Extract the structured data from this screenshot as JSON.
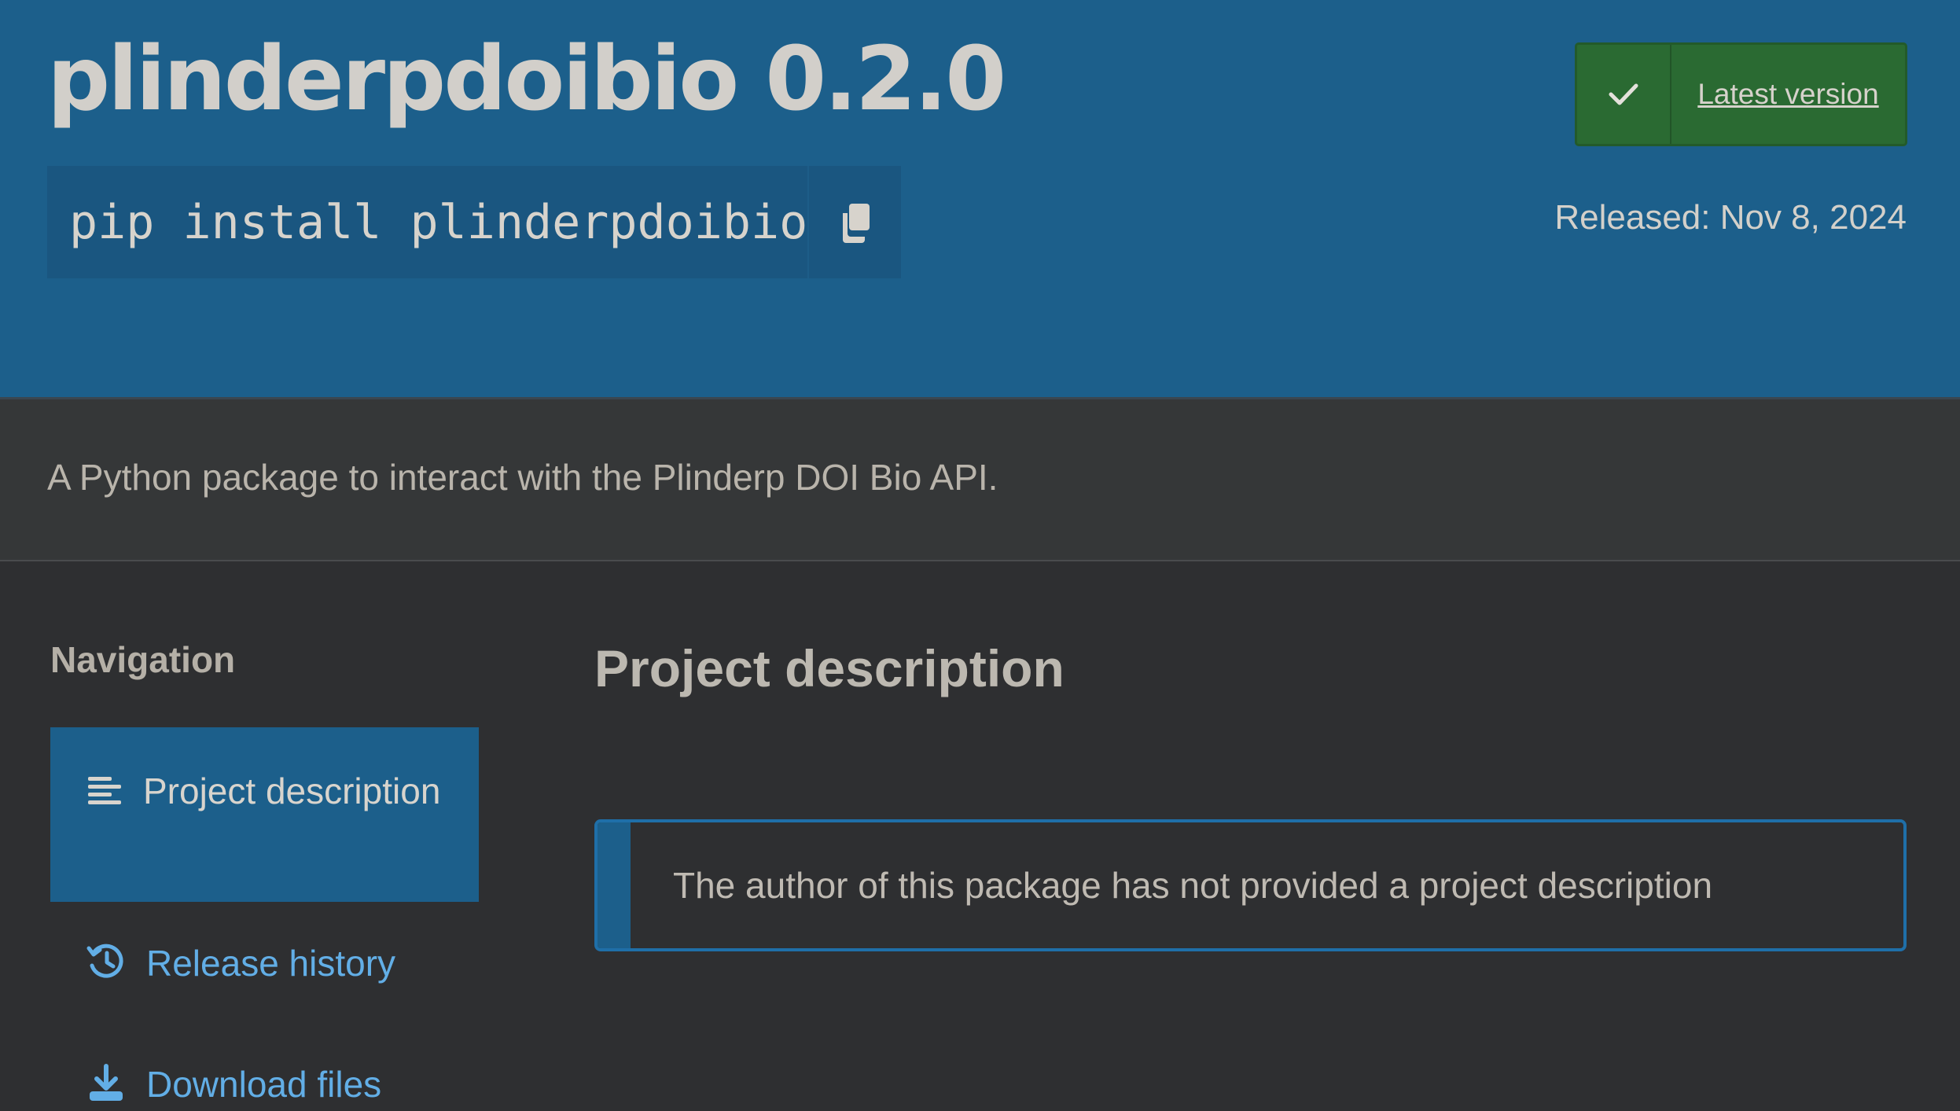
{
  "package": {
    "name_version": "plinderpdoibio 0.2.0",
    "install_command": "pip install plinderpdoibio",
    "latest_label": "Latest version",
    "released": "Released: Nov 8, 2024",
    "summary": "A Python package to interact with the Plinderp DOI Bio API."
  },
  "sidebar": {
    "heading": "Navigation",
    "items": [
      {
        "label": "Project description",
        "icon": "align-left-icon"
      },
      {
        "label": "Release history",
        "icon": "history-icon"
      },
      {
        "label": "Download files",
        "icon": "download-icon"
      }
    ]
  },
  "main": {
    "heading": "Project description",
    "callout": "The author of this package has not provided a project description"
  },
  "colors": {
    "header_bg": "#1c5f8b",
    "page_bg": "#2e2f31",
    "latest_bg": "#2a6a32",
    "link": "#62aee6"
  }
}
